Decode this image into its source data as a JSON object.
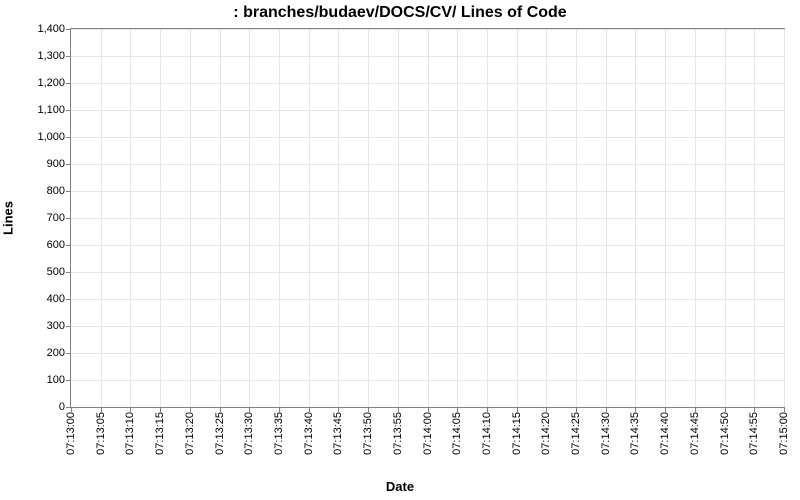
{
  "chart_data": {
    "type": "line",
    "title": ": branches/budaev/DOCS/CV/ Lines of Code",
    "xlabel": "Date",
    "ylabel": "Lines",
    "ylim": [
      0,
      1400
    ],
    "y_ticks": [
      0,
      100,
      200,
      300,
      400,
      500,
      600,
      700,
      800,
      900,
      1000,
      1100,
      1200,
      1300,
      1400
    ],
    "y_tick_labels": [
      "0",
      "100",
      "200",
      "300",
      "400",
      "500",
      "600",
      "700",
      "800",
      "900",
      "1,000",
      "1,100",
      "1,200",
      "1,300",
      "1,400"
    ],
    "x_tick_labels": [
      "07:13:00",
      "07:13:05",
      "07:13:10",
      "07:13:15",
      "07:13:20",
      "07:13:25",
      "07:13:30",
      "07:13:35",
      "07:13:40",
      "07:13:45",
      "07:13:50",
      "07:13:55",
      "07:14:00",
      "07:14:05",
      "07:14:10",
      "07:14:15",
      "07:14:20",
      "07:14:25",
      "07:14:30",
      "07:14:35",
      "07:14:40",
      "07:14:45",
      "07:14:50",
      "07:14:55",
      "07:15:00"
    ],
    "series": []
  }
}
